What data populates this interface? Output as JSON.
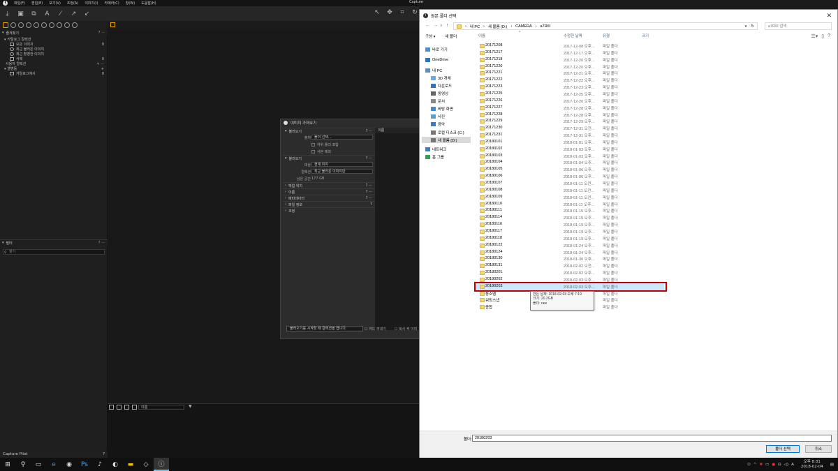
{
  "capture_one": {
    "window_title": "Capture",
    "menu": [
      "파일(F)",
      "편집(E)",
      "보기(V)",
      "조정(A)",
      "이미지(I)",
      "카메라(C)",
      "창(W)",
      "도움말(H)"
    ],
    "library": {
      "favorites_title": "즐겨찾기",
      "catalog_collections_title": "카탈로그 컬렉션",
      "items": [
        {
          "label": "모든 이미지",
          "count": "0"
        },
        {
          "label": "최근 불러온 이미지",
          "count": ""
        },
        {
          "label": "최근 촬영한 이미지",
          "count": ""
        },
        {
          "label": "삭제",
          "count": "0"
        }
      ],
      "user_collections_title": "사용자 컬렉션",
      "albums_title": "앨범들",
      "album_item": {
        "label": "카탈로그에서",
        "count": "0"
      }
    },
    "filter": {
      "title": "필터",
      "placeholder": "찾기"
    },
    "capture_pilot": "Capture Pilot",
    "sort_label": "이름"
  },
  "import_dialog": {
    "title": "이미지 가져오기",
    "name_header": "이름",
    "source_section": "불러오기",
    "source_label": "출처",
    "source_value": "폴더 선택...",
    "include_subfolders": "하위 폴더 포함",
    "exclude_duplicates": "사본 제외",
    "dest_section": "불러오기",
    "target_label": "대상",
    "target_value": "현재 위치",
    "collection_label": "컬렉션",
    "collection_value": "최근 불러온 이미지만",
    "space_label": "남은 공간",
    "space_value": "177 GB",
    "sections": [
      "백업 위치",
      "이름",
      "메타데이터",
      "파일 정보",
      "조정"
    ],
    "bottom_select": "불러오기를 시작할 때 컬렉션을 엽니다.",
    "card_check": "카드 꺼내기",
    "copy_check": "복사 후 이미"
  },
  "folder_dialog": {
    "title": "원본 폴더 선택",
    "breadcrumb": [
      "내 PC",
      "새 볼륨 (D:)",
      "CAMERA",
      "a7RIII"
    ],
    "search_placeholder": "a7RIII 검색",
    "toolbar": {
      "organize": "구성 ▾",
      "new_folder": "새 폴더"
    },
    "columns": {
      "name": "이름",
      "date": "수정한 날짜",
      "type": "유형",
      "size": "크기"
    },
    "nav": [
      {
        "label": "바로 가기",
        "icon": "star-icon"
      },
      {
        "label": "OneDrive",
        "icon": "cloud-icon"
      },
      {
        "label": "내 PC",
        "icon": "pc-icon"
      },
      {
        "label": "3D 개체",
        "icon": "cube-icon"
      },
      {
        "label": "다운로드",
        "icon": "download-icon"
      },
      {
        "label": "동영상",
        "icon": "video-icon"
      },
      {
        "label": "문서",
        "icon": "document-icon"
      },
      {
        "label": "바탕 화면",
        "icon": "desktop-icon"
      },
      {
        "label": "사진",
        "icon": "picture-icon"
      },
      {
        "label": "음악",
        "icon": "music-icon"
      },
      {
        "label": "로컬 디스크 (C:)",
        "icon": "drive-icon"
      },
      {
        "label": "새 볼륨 (D:)",
        "icon": "drive-icon"
      },
      {
        "label": "네트워크",
        "icon": "network-icon"
      },
      {
        "label": "홈 그룹",
        "icon": "homegroup-icon"
      }
    ],
    "folders": [
      {
        "name": "20171208",
        "date": "2017-12-08 오후...",
        "type": "파일 폴더"
      },
      {
        "name": "20171217",
        "date": "2017-12-17 오후...",
        "type": "파일 폴더"
      },
      {
        "name": "20171218",
        "date": "2017-12-20 오후...",
        "type": "파일 폴더"
      },
      {
        "name": "20171220",
        "date": "2017-12-20 오후...",
        "type": "파일 폴더"
      },
      {
        "name": "20171221",
        "date": "2017-12-21 오후...",
        "type": "파일 폴더"
      },
      {
        "name": "20171222",
        "date": "2017-12-22 오후...",
        "type": "파일 폴더"
      },
      {
        "name": "20171223",
        "date": "2017-12-23 오후...",
        "type": "파일 폴더"
      },
      {
        "name": "20171225",
        "date": "2017-12-25 오후...",
        "type": "파일 폴더"
      },
      {
        "name": "20171226",
        "date": "2017-12-26 오후...",
        "type": "파일 폴더"
      },
      {
        "name": "20171227",
        "date": "2017-12-28 오후...",
        "type": "파일 폴더"
      },
      {
        "name": "20171228",
        "date": "2017-12-28 오후...",
        "type": "파일 폴더"
      },
      {
        "name": "20171229",
        "date": "2017-12-29 오후...",
        "type": "파일 폴더"
      },
      {
        "name": "20171230",
        "date": "2017-12-31 오전...",
        "type": "파일 폴더"
      },
      {
        "name": "20171231",
        "date": "2017-12-31 오후...",
        "type": "파일 폴더"
      },
      {
        "name": "20180101",
        "date": "2018-01-01 오후...",
        "type": "파일 폴더"
      },
      {
        "name": "20180102",
        "date": "2018-01-03 오후...",
        "type": "파일 폴더"
      },
      {
        "name": "20180103",
        "date": "2018-01-03 오후...",
        "type": "파일 폴더"
      },
      {
        "name": "20180104",
        "date": "2018-01-04 오후...",
        "type": "파일 폴더"
      },
      {
        "name": "20180105",
        "date": "2018-01-06 오후...",
        "type": "파일 폴더"
      },
      {
        "name": "20180106",
        "date": "2018-01-06 오후...",
        "type": "파일 폴더"
      },
      {
        "name": "20180107",
        "date": "2018-01-11 오전...",
        "type": "파일 폴더"
      },
      {
        "name": "20180108",
        "date": "2018-01-11 오전...",
        "type": "파일 폴더"
      },
      {
        "name": "20180109",
        "date": "2018-01-11 오전...",
        "type": "파일 폴더"
      },
      {
        "name": "20180110",
        "date": "2018-01-11 오후...",
        "type": "파일 폴더"
      },
      {
        "name": "20180111",
        "date": "2018-01-15 오후...",
        "type": "파일 폴더"
      },
      {
        "name": "20180114",
        "date": "2018-01-15 오후...",
        "type": "파일 폴더"
      },
      {
        "name": "20180116",
        "date": "2018-01-19 오후...",
        "type": "파일 폴더"
      },
      {
        "name": "20180117",
        "date": "2018-01-19 오후...",
        "type": "파일 폴더"
      },
      {
        "name": "20180118",
        "date": "2018-01-19 오후...",
        "type": "파일 폴더"
      },
      {
        "name": "20180122",
        "date": "2018-01-24 오후...",
        "type": "파일 폴더"
      },
      {
        "name": "20180124",
        "date": "2018-01-24 오후...",
        "type": "파일 폴더"
      },
      {
        "name": "20180130",
        "date": "2018-01-30 오후...",
        "type": "파일 폴더"
      },
      {
        "name": "20180131",
        "date": "2018-02-02 오전...",
        "type": "파일 폴더"
      },
      {
        "name": "20180201",
        "date": "2018-02-02 오후...",
        "type": "파일 폴더"
      },
      {
        "name": "20180202",
        "date": "2018-02-03 오후...",
        "type": "파일 폴더"
      },
      {
        "name": "20180203",
        "date": "2018-02-03 오후...",
        "type": "파일 폴더"
      },
      {
        "name": "동소앱",
        "date": "",
        "type": "파일 폴더"
      },
      {
        "name": "워밍스냅",
        "date": "",
        "type": "파일 폴더"
      },
      {
        "name": "종합",
        "date": "",
        "type": "파일 폴더"
      }
    ],
    "tooltip": {
      "created": "만든 날짜: 2018-02-03 오후 7:19",
      "size": "크기: 20.2GB",
      "folder": "폴더: raw"
    },
    "folder_label": "폴더:",
    "folder_value": "20180203",
    "ok_button": "폴더 선택",
    "cancel_button": "취소"
  },
  "taskbar": {
    "time": "오후 8:31",
    "date": "2018-02-04",
    "ime": "A"
  }
}
